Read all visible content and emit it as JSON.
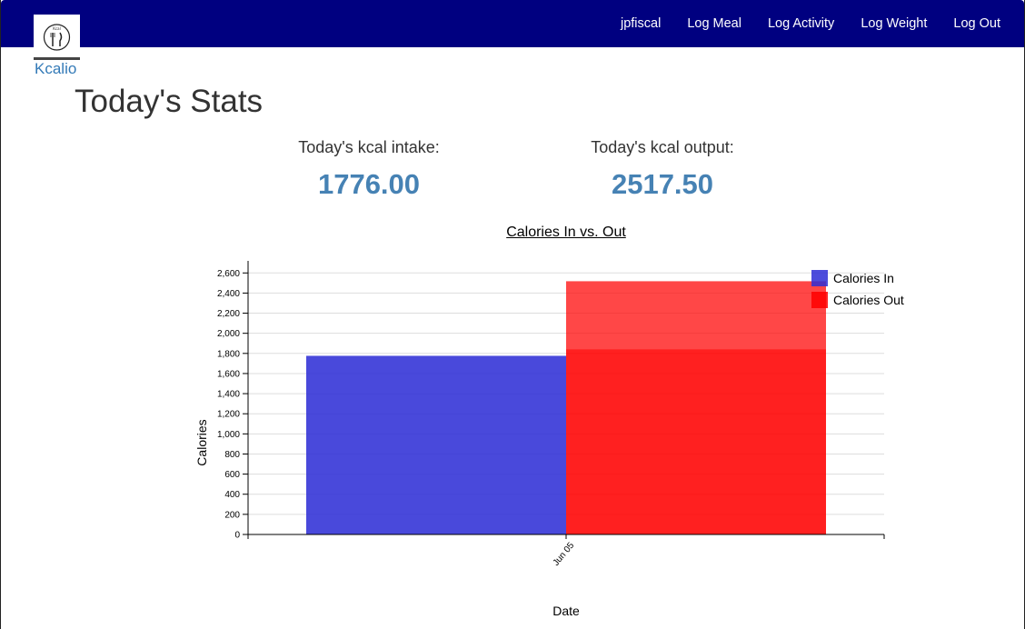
{
  "nav": {
    "brand": "Kcalio",
    "links": [
      "jpfiscal",
      "Log Meal",
      "Log Activity",
      "Log Weight",
      "Log Out"
    ]
  },
  "page": {
    "title": "Today's Stats"
  },
  "stats": {
    "intake_label": "Today's kcal intake:",
    "intake_value": "1776.00",
    "output_label": "Today's kcal output:",
    "output_value": "2517.50"
  },
  "colors": {
    "navbar": "#000080",
    "link": "#337ab7",
    "stat_value": "#4682b4",
    "calories_in": "#2e2ed6",
    "calories_out": "#ff0000"
  },
  "chart_data": {
    "type": "bar",
    "title": "Calories In vs. Out",
    "xlabel": "Date",
    "ylabel": "Calories",
    "categories": [
      "Jun 05"
    ],
    "series": [
      {
        "name": "Calories In",
        "values": [
          1776
        ]
      },
      {
        "name": "Calories Out",
        "values": [
          2517.5
        ]
      }
    ],
    "ylim": [
      0,
      2720
    ],
    "yticks": [
      0,
      200,
      400,
      600,
      800,
      1000,
      1200,
      1400,
      1600,
      1800,
      2000,
      2200,
      2400,
      2600
    ],
    "ytick_labels": [
      "0",
      "200",
      "400",
      "600",
      "800",
      "1,000",
      "1,200",
      "1,400",
      "1,600",
      "1,800",
      "2,000",
      "2,200",
      "2,400",
      "2,600"
    ],
    "grid": true,
    "legend": "top-right"
  }
}
